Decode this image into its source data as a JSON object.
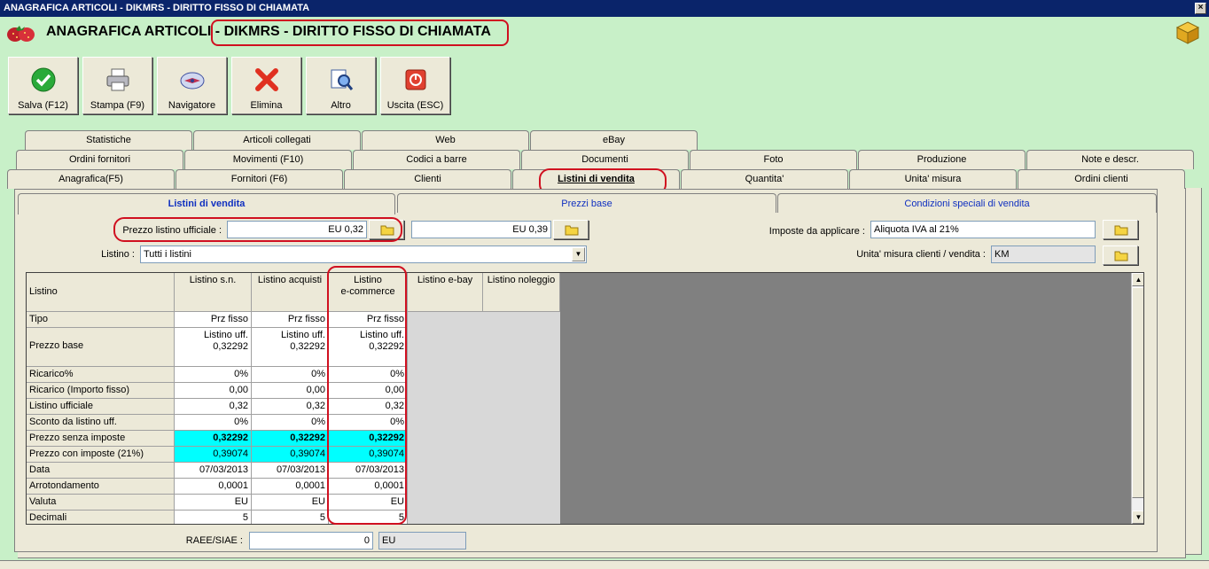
{
  "window": {
    "title": "ANAGRAFICA ARTICOLI - DIKMRS - DIRITTO FISSO DI CHIAMATA"
  },
  "header": {
    "title": "ANAGRAFICA ARTICOLI - DIKMRS - DIRITTO FISSO DI CHIAMATA"
  },
  "toolbar": {
    "save": "Salva (F12)",
    "print": "Stampa (F9)",
    "navigator": "Navigatore",
    "delete": "Elimina",
    "other": "Altro",
    "exit": "Uscita (ESC)"
  },
  "tabs": {
    "row1": [
      "Statistiche",
      "Articoli collegati",
      "Web",
      "eBay"
    ],
    "row2": [
      "Ordini fornitori",
      "Movimenti (F10)",
      "Codici a barre",
      "Documenti",
      "Foto",
      "Produzione",
      "Note e descr."
    ],
    "row3": [
      "Anagrafica(F5)",
      "Fornitori (F6)",
      "Clienti",
      "Listini di vendita",
      "Quantita'",
      "Unita' misura",
      "Ordini clienti"
    ]
  },
  "subtabs": [
    "Listini di vendita",
    "Prezzi base",
    "Condizioni speciali di vendita"
  ],
  "form": {
    "official_price_label": "Prezzo listino ufficiale :",
    "official_price_value": "EU 0,32",
    "second_price_value": "EU 0,39",
    "taxes_label": "Imposte da applicare :",
    "taxes_value": "Aliquota IVA al 21%",
    "listino_label": "Listino :",
    "listino_value": "Tutti i listini",
    "unit_label": "Unita' misura clienti / vendita :",
    "unit_value": "KM",
    "raee_label": "RAEE/SIAE :",
    "raee_value": "0",
    "raee_currency": "EU"
  },
  "grid": {
    "corner": "Listino",
    "columns": [
      "Listino s.n.",
      "Listino acquisti",
      "Listino\ne-commerce",
      "Listino e-bay",
      "Listino noleggio"
    ],
    "row_labels": [
      "Tipo",
      "Prezzo base",
      "Ricarico%",
      "Ricarico (Importo fisso)",
      "Listino ufficiale",
      "Sconto da listino uff.",
      "Prezzo senza imposte",
      "Prezzo con imposte (21%)",
      "Data",
      "Arrotondamento",
      "Valuta",
      "Decimali"
    ],
    "values": [
      [
        "Prz fisso",
        "Prz fisso",
        "Prz fisso"
      ],
      [
        "Listino uff.\n0,32292",
        "Listino uff.\n0,32292",
        "Listino uff.\n0,32292"
      ],
      [
        "0%",
        "0%",
        "0%"
      ],
      [
        "0,00",
        "0,00",
        "0,00"
      ],
      [
        "0,32",
        "0,32",
        "0,32"
      ],
      [
        "0%",
        "0%",
        "0%"
      ],
      [
        "0,32292",
        "0,32292",
        "0,32292"
      ],
      [
        "0,39074",
        "0,39074",
        "0,39074"
      ],
      [
        "07/03/2013",
        "07/03/2013",
        "07/03/2013"
      ],
      [
        "0,0001",
        "0,0001",
        "0,0001"
      ],
      [
        "EU",
        "EU",
        "EU"
      ],
      [
        "5",
        "5",
        "5"
      ]
    ]
  },
  "colors": {
    "titlebar": "#0a246a",
    "highlight": "#00ffff",
    "annotation": "#d01020",
    "background": "#c8f0c8"
  }
}
